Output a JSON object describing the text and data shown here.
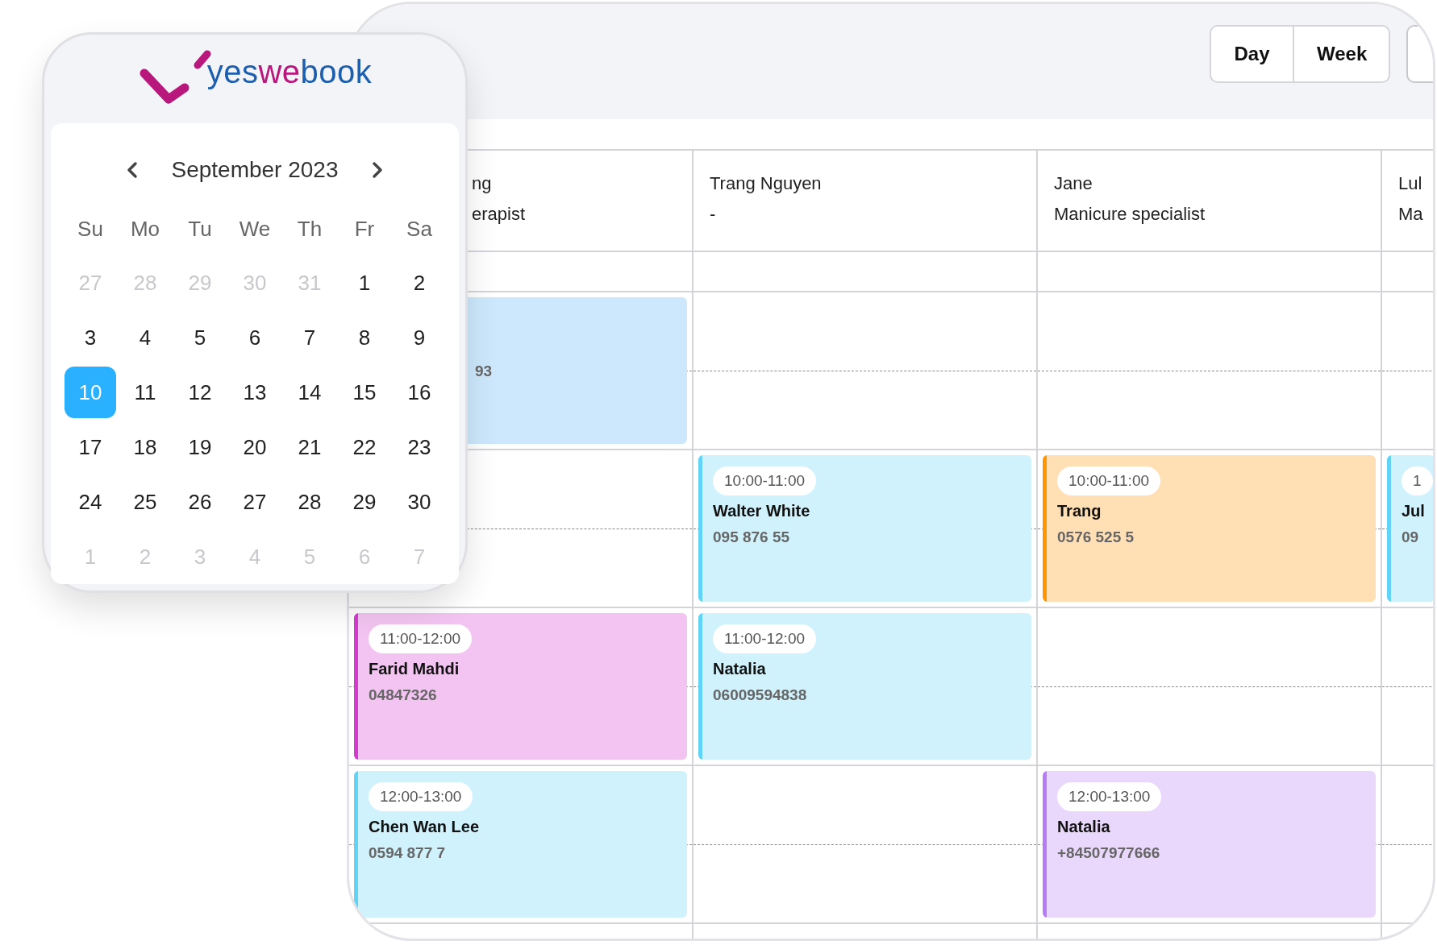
{
  "logo": {
    "parts": [
      {
        "text": "yes",
        "color": "#1d5fae"
      },
      {
        "text": "we",
        "color": "#b8177c"
      },
      {
        "text": "book",
        "color": "#1d5fae"
      }
    ]
  },
  "mini_calendar": {
    "month": "September 2023",
    "weekdays": [
      "Su",
      "Mo",
      "Tu",
      "We",
      "Th",
      "Fr",
      "Sa"
    ],
    "weeks": [
      [
        {
          "day": "27",
          "muted": true,
          "selected": false
        },
        {
          "day": "28",
          "muted": true,
          "selected": false
        },
        {
          "day": "29",
          "muted": true,
          "selected": false
        },
        {
          "day": "30",
          "muted": true,
          "selected": false
        },
        {
          "day": "31",
          "muted": true,
          "selected": false
        },
        {
          "day": "1",
          "muted": false,
          "selected": false
        },
        {
          "day": "2",
          "muted": false,
          "selected": false
        }
      ],
      [
        {
          "day": "3",
          "muted": false,
          "selected": false
        },
        {
          "day": "4",
          "muted": false,
          "selected": false
        },
        {
          "day": "5",
          "muted": false,
          "selected": false
        },
        {
          "day": "6",
          "muted": false,
          "selected": false
        },
        {
          "day": "7",
          "muted": false,
          "selected": false
        },
        {
          "day": "8",
          "muted": false,
          "selected": false
        },
        {
          "day": "9",
          "muted": false,
          "selected": false
        }
      ],
      [
        {
          "day": "10",
          "muted": false,
          "selected": true
        },
        {
          "day": "11",
          "muted": false,
          "selected": false
        },
        {
          "day": "12",
          "muted": false,
          "selected": false
        },
        {
          "day": "13",
          "muted": false,
          "selected": false
        },
        {
          "day": "14",
          "muted": false,
          "selected": false
        },
        {
          "day": "15",
          "muted": false,
          "selected": false
        },
        {
          "day": "16",
          "muted": false,
          "selected": false
        }
      ],
      [
        {
          "day": "17",
          "muted": false,
          "selected": false
        },
        {
          "day": "18",
          "muted": false,
          "selected": false
        },
        {
          "day": "19",
          "muted": false,
          "selected": false
        },
        {
          "day": "20",
          "muted": false,
          "selected": false
        },
        {
          "day": "21",
          "muted": false,
          "selected": false
        },
        {
          "day": "22",
          "muted": false,
          "selected": false
        },
        {
          "day": "23",
          "muted": false,
          "selected": false
        }
      ],
      [
        {
          "day": "24",
          "muted": false,
          "selected": false
        },
        {
          "day": "25",
          "muted": false,
          "selected": false
        },
        {
          "day": "26",
          "muted": false,
          "selected": false
        },
        {
          "day": "27",
          "muted": false,
          "selected": false
        },
        {
          "day": "28",
          "muted": false,
          "selected": false
        },
        {
          "day": "29",
          "muted": false,
          "selected": false
        },
        {
          "day": "30",
          "muted": false,
          "selected": false
        }
      ],
      [
        {
          "day": "1",
          "muted": true,
          "selected": false
        },
        {
          "day": "2",
          "muted": true,
          "selected": false
        },
        {
          "day": "3",
          "muted": true,
          "selected": false
        },
        {
          "day": "4",
          "muted": true,
          "selected": false
        },
        {
          "day": "5",
          "muted": true,
          "selected": false
        },
        {
          "day": "6",
          "muted": true,
          "selected": false
        },
        {
          "day": "7",
          "muted": true,
          "selected": false
        }
      ]
    ]
  },
  "view_buttons": [
    "Day",
    "Week"
  ],
  "staff_columns": [
    {
      "name": "ng",
      "role": "erapist"
    },
    {
      "name": "Trang Nguyen",
      "role": "-"
    },
    {
      "name": "Jane",
      "role": "Manicure specialist"
    },
    {
      "name": "Lul",
      "role": "Ma"
    }
  ],
  "hour_rows": [
    {
      "cells": [
        {
          "phone": "93"
        },
        null,
        null,
        null
      ]
    },
    {
      "cells": [
        null,
        {
          "time": "10:00-11:00",
          "name": "Walter White",
          "phone": "095 876 55",
          "color": "#62d2f7"
        },
        {
          "time": "10:00-11:00",
          "name": "Trang",
          "phone": "0576 525 5",
          "color": "#ff9500"
        },
        {
          "time": "1",
          "name": "Jul",
          "phone": "09",
          "color": "#62d2f7"
        }
      ]
    },
    {
      "cells": [
        {
          "time": "11:00-12:00",
          "name": "Farid Mahdi",
          "phone": "04847326",
          "color": "#d63bd0"
        },
        {
          "time": "11:00-12:00",
          "name": "Natalia",
          "phone": "06009594838",
          "color": "#62d2f7"
        },
        null,
        null
      ]
    },
    {
      "cells": [
        {
          "time": "12:00-13:00",
          "name": "Chen Wan Lee",
          "phone": "0594 877 7",
          "color": "#62d2f7"
        },
        null,
        {
          "time": "12:00-13:00",
          "name": "Natalia",
          "phone": "+84507977666",
          "color": "#b57cf5"
        },
        null
      ]
    }
  ]
}
